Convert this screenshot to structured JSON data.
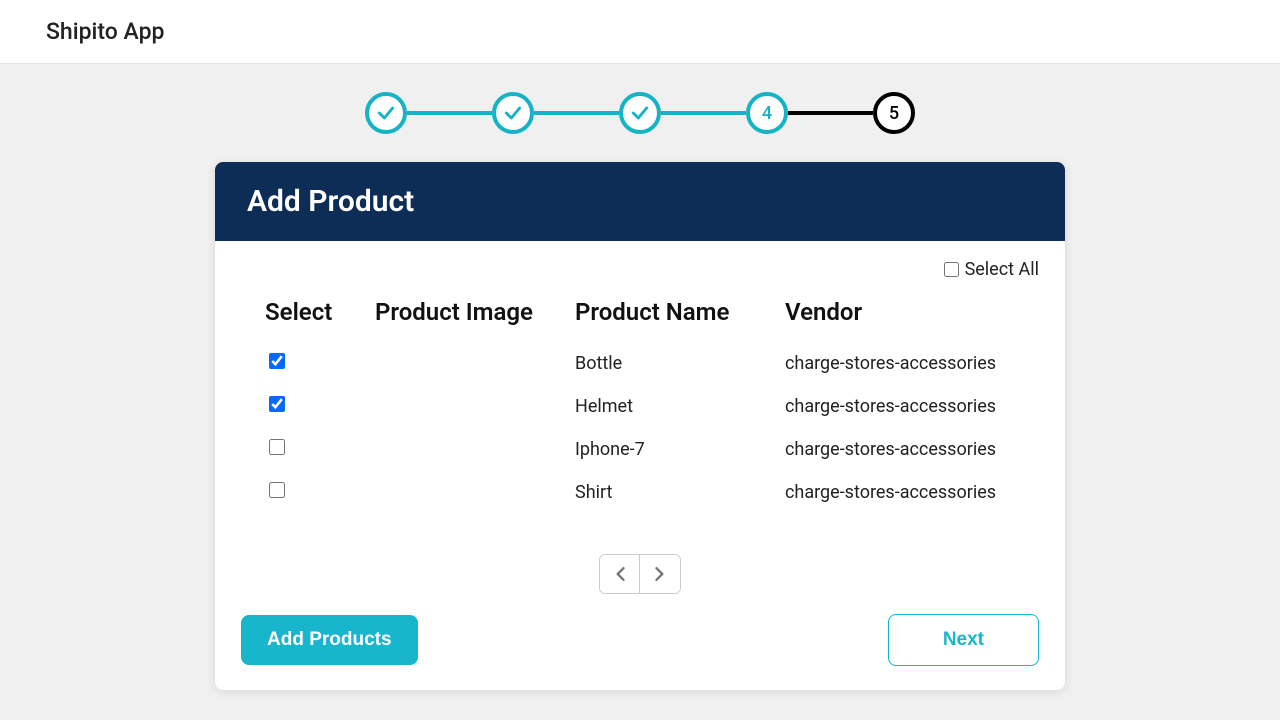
{
  "app": {
    "title": "Shipito App"
  },
  "stepper": {
    "steps": [
      {
        "state": "done"
      },
      {
        "state": "done"
      },
      {
        "state": "done"
      },
      {
        "state": "current",
        "label": "4"
      },
      {
        "state": "pending",
        "label": "5"
      }
    ]
  },
  "card": {
    "title": "Add Product",
    "selectAllLabel": "Select All",
    "selectAllChecked": false,
    "columns": {
      "select": "Select",
      "image": "Product Image",
      "name": "Product Name",
      "vendor": "Vendor"
    },
    "rows": [
      {
        "checked": true,
        "name": "Bottle",
        "vendor": "charge-stores-accessories"
      },
      {
        "checked": true,
        "name": "Helmet",
        "vendor": "charge-stores-accessories"
      },
      {
        "checked": false,
        "name": "Iphone-7",
        "vendor": "charge-stores-accessories"
      },
      {
        "checked": false,
        "name": "Shirt",
        "vendor": "charge-stores-accessories"
      }
    ],
    "buttons": {
      "add": "Add Products",
      "next": "Next"
    }
  }
}
